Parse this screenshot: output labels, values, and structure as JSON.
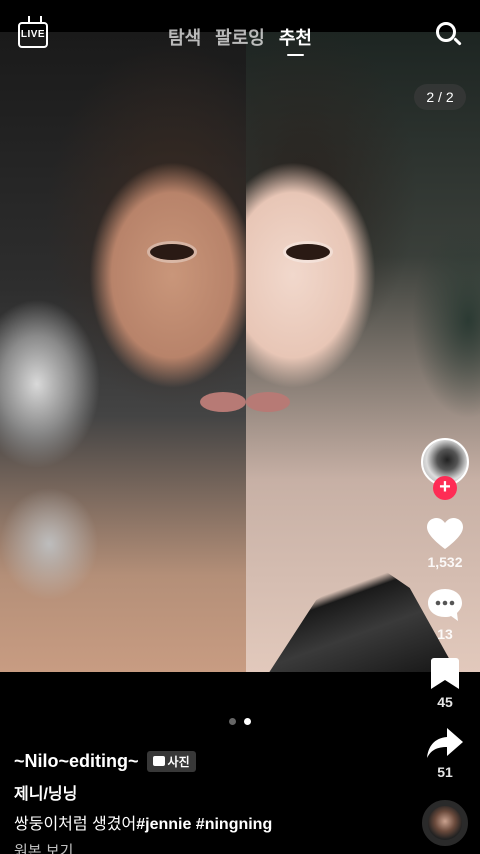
{
  "top_nav": {
    "live_label": "LIVE",
    "tabs": [
      {
        "label": "탐색",
        "active": false
      },
      {
        "label": "팔로잉",
        "active": false
      },
      {
        "label": "추천",
        "active": true
      }
    ],
    "search_icon": "search-icon"
  },
  "post": {
    "page_counter": "2 / 2",
    "current_page": 2,
    "total_pages": 2,
    "username": "~Nilo~editing~",
    "media_badge": "사진",
    "title": "제니/닝닝",
    "description_text": "쌍둥이처럼 생겼어",
    "hashtags": "#jennie #ningning",
    "show_original": "원본 보기"
  },
  "actions": {
    "likes": "1,532",
    "comments": "13",
    "saves": "45",
    "shares": "51"
  },
  "colors": {
    "accent": "#fe2c55",
    "background": "#000000",
    "text": "#ffffff"
  }
}
